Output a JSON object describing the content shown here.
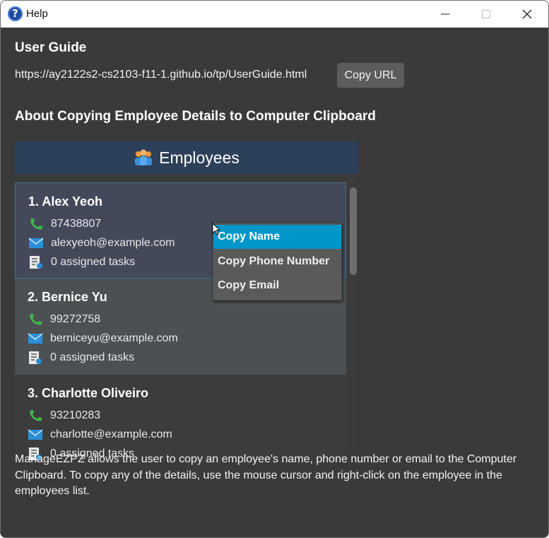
{
  "window": {
    "title": "Help",
    "icon": "help-question-icon"
  },
  "user_guide": {
    "heading": "User Guide",
    "url": "https://ay2122s2-cs2103-f11-1.github.io/tp/UserGuide.html",
    "copy_button": "Copy URL"
  },
  "copying_section": {
    "heading": "About Copying Employee Details to Computer Clipboard",
    "panel_title": "Employees",
    "employees": [
      {
        "name": "1.  Alex Yeoh",
        "phone": "87438807",
        "email": "alexyeoh@example.com",
        "tasks": "0 assigned tasks"
      },
      {
        "name": "2.  Bernice Yu",
        "phone": "99272758",
        "email": "berniceyu@example.com",
        "tasks": "0 assigned tasks"
      },
      {
        "name": "3.  Charlotte Oliveiro",
        "phone": "93210283",
        "email": "charlotte@example.com",
        "tasks": "0 assigned tasks"
      }
    ],
    "context_menu": {
      "items": [
        "Copy Name",
        "Copy Phone Number",
        "Copy Email"
      ],
      "selected": "Copy Name"
    },
    "description": "ManageEZPZ allows the user to copy an employee's name, phone number or email to the Computer Clipboard. To copy any of the details, use the mouse cursor and right-click on the employee in the employees list."
  },
  "colors": {
    "background": "#3a3a3a",
    "header": "#2d4059",
    "selected_menu": "#0096c9",
    "phone_icon": "#3db54a",
    "email_icon": "#2a8fd6"
  }
}
